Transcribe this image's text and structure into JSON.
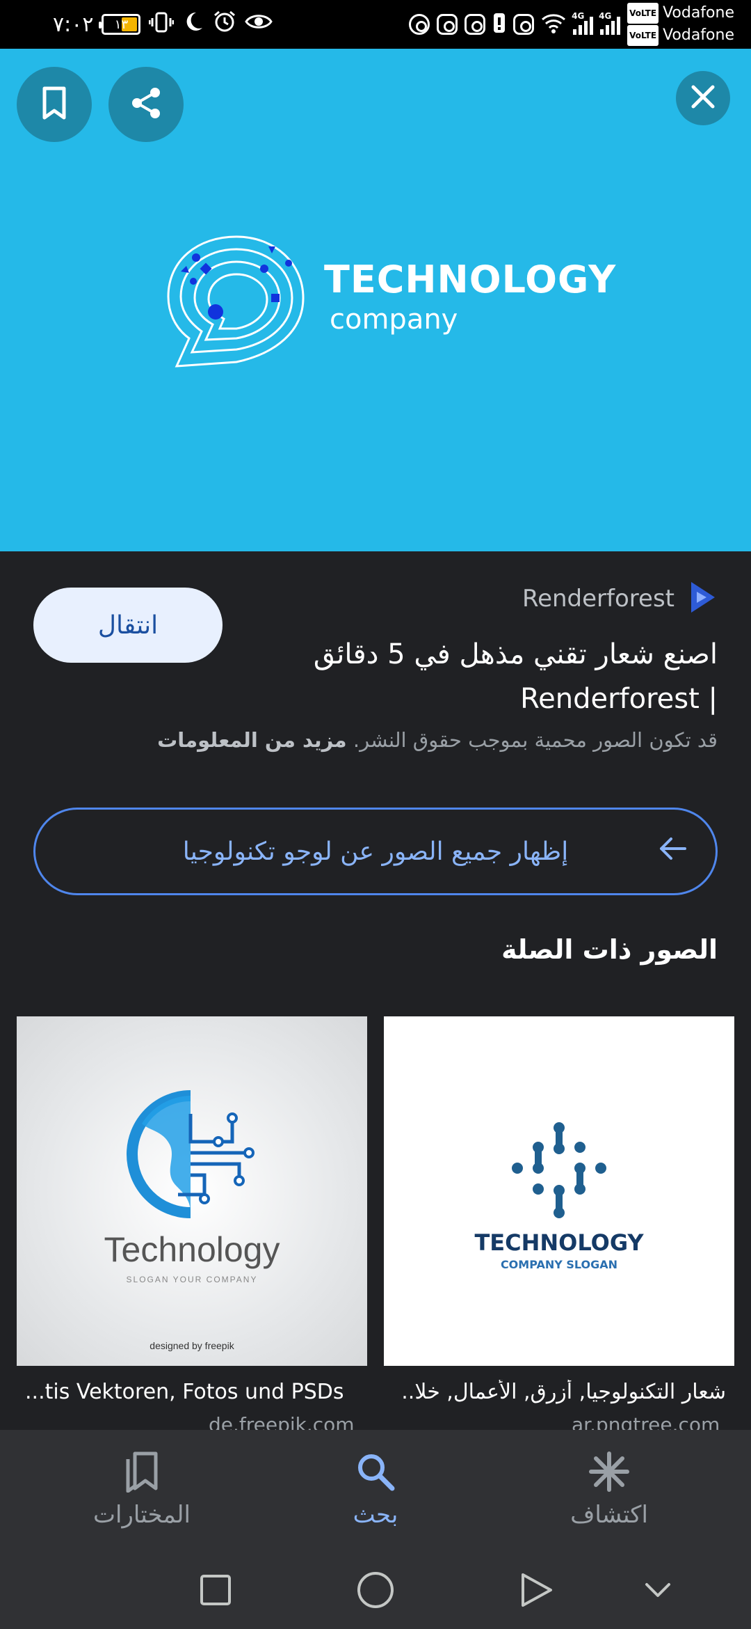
{
  "status_bar": {
    "time": "٧:٠٢",
    "battery": "١٣",
    "carriers": [
      {
        "badge": "VoLTE",
        "name": "Vodafone"
      },
      {
        "badge": "VoLTE",
        "name": "Vodafone"
      }
    ],
    "network_1": "4G",
    "network_2": "4G"
  },
  "hero": {
    "bg_color": "#25b9e8",
    "logo_title": "TECHNOLOGY",
    "logo_subtitle": "company",
    "bookmark_icon": "bookmark-icon",
    "share_icon": "share-icon",
    "close_icon": "close-icon"
  },
  "info": {
    "source_name": "Renderforest",
    "visit_label": "انتقال",
    "page_title": "اصنع شعار تقني مذهل في 5 دقائق | Renderforest",
    "copyright_text": "قد تكون الصور محمية بموجب حقوق النشر.",
    "more_info": "مزيد من المعلومات",
    "show_all_label": "إظهار جميع الصور عن لوجو تكنولوجيا",
    "related_title": "الصور ذات الصلة"
  },
  "related": [
    {
      "caption": "...tis Vektoren, Fotos und PSDs",
      "domain": "de.freepik.com",
      "logo_text": "Technology",
      "slogan": "SLOGAN YOUR COMPANY",
      "credit": "designed by freepik"
    },
    {
      "caption": "شعار التكنولوجيا, أزرق, الأعمال, خلا...",
      "domain": "ar.pngtree.com",
      "logo_text": "TECHNOLOGY",
      "slogan": "COMPANY SLOGAN"
    }
  ],
  "bottom_nav": {
    "items": [
      {
        "label": "المختارات",
        "icon": "collections-icon"
      },
      {
        "label": "بحث",
        "icon": "search-icon"
      },
      {
        "label": "اكتشاف",
        "icon": "discover-icon"
      }
    ],
    "active_color": "#8ab4f8"
  },
  "system_nav": {
    "buttons": [
      "recents-icon",
      "home-icon",
      "back-icon",
      "hide-icon"
    ]
  }
}
